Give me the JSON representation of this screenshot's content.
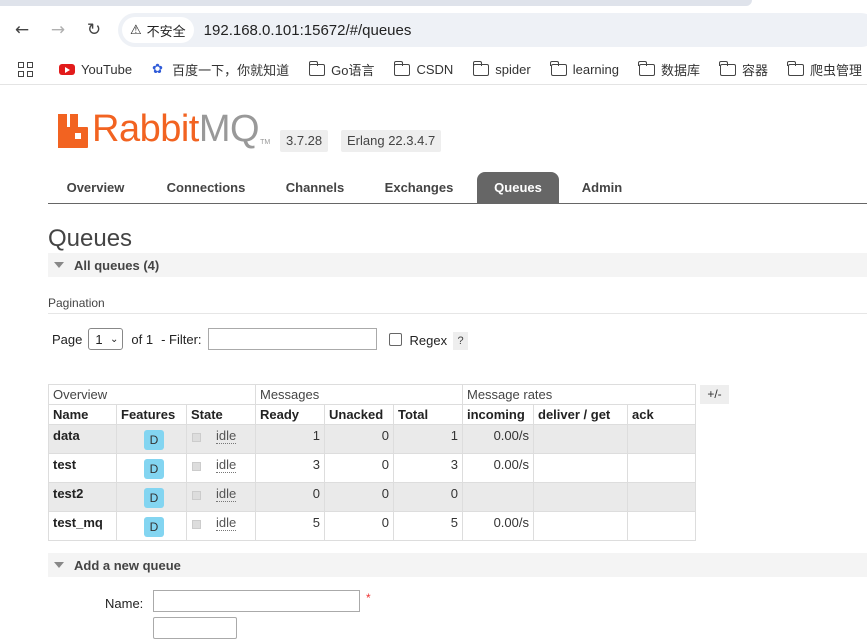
{
  "browser": {
    "security_label": "不安全",
    "url": "192.168.0.101:15672/#/queues",
    "bookmarks": [
      "YouTube",
      "百度一下，你就知道",
      "Go语言",
      "CSDN",
      "spider",
      "learning",
      "数据库",
      "容器",
      "爬虫管理"
    ]
  },
  "header": {
    "logo_rabbit": "Rabbit",
    "logo_mq": "MQ",
    "logo_tm": "TM",
    "version": "3.7.28",
    "erlang": "Erlang 22.3.4.7"
  },
  "tabs": [
    "Overview",
    "Connections",
    "Channels",
    "Exchanges",
    "Queues",
    "Admin"
  ],
  "active_tab": "Queues",
  "page": {
    "title": "Queues",
    "all_queues_label": "All queues (4)",
    "pagination_label": "Pagination",
    "page_label": "Page",
    "page_value": "1",
    "of_label": "of 1",
    "filter_label": "- Filter:",
    "filter_value": "",
    "regex_label": "Regex",
    "help_label": "?",
    "columns_toggle": "+/-"
  },
  "table": {
    "groups": [
      "Overview",
      "Messages",
      "Message rates"
    ],
    "headers": [
      "Name",
      "Features",
      "State",
      "Ready",
      "Unacked",
      "Total",
      "incoming",
      "deliver / get",
      "ack"
    ],
    "rows": [
      {
        "name": "data",
        "feature": "D",
        "state": "idle",
        "ready": "1",
        "unacked": "0",
        "total": "1",
        "incoming": "0.00/s",
        "deliver": "",
        "ack": ""
      },
      {
        "name": "test",
        "feature": "D",
        "state": "idle",
        "ready": "3",
        "unacked": "0",
        "total": "3",
        "incoming": "0.00/s",
        "deliver": "",
        "ack": ""
      },
      {
        "name": "test2",
        "feature": "D",
        "state": "idle",
        "ready": "0",
        "unacked": "0",
        "total": "0",
        "incoming": "",
        "deliver": "",
        "ack": ""
      },
      {
        "name": "test_mq",
        "feature": "D",
        "state": "idle",
        "ready": "5",
        "unacked": "0",
        "total": "5",
        "incoming": "0.00/s",
        "deliver": "",
        "ack": ""
      }
    ]
  },
  "add_queue": {
    "title": "Add a new queue",
    "name_label": "Name:",
    "name_value": "",
    "required": "*"
  },
  "colors": {
    "brand_orange": "#f26321",
    "tab_active": "#666666",
    "feature_badge": "#83d5f1"
  }
}
